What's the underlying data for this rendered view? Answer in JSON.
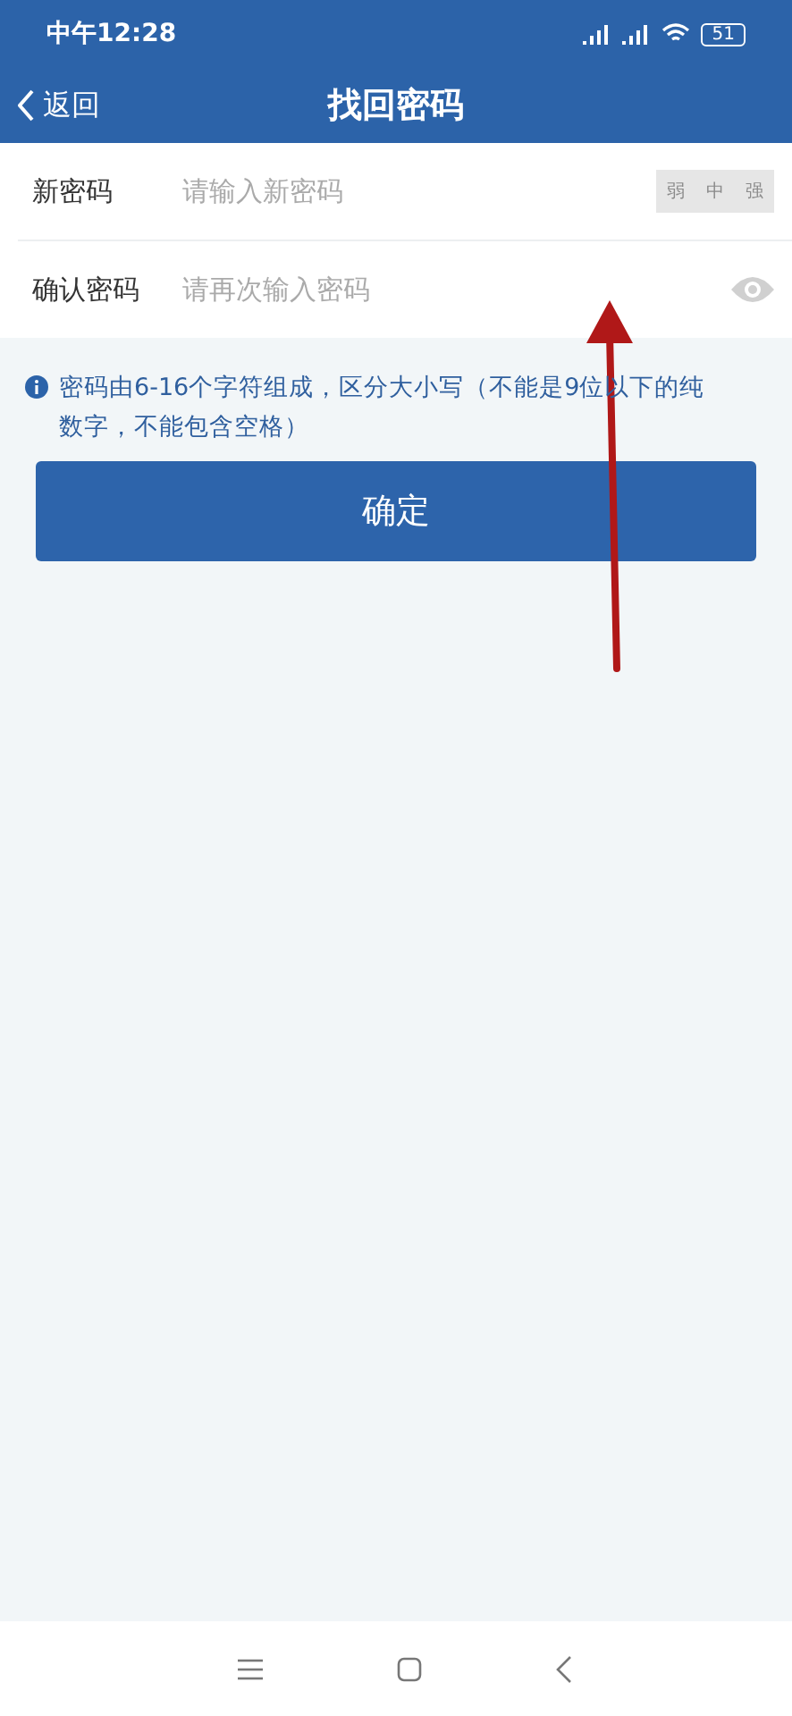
{
  "status_bar": {
    "time": "中午12:28",
    "battery": "51"
  },
  "header": {
    "back": "返回",
    "title": "找回密码"
  },
  "fields": [
    {
      "kind": "strength",
      "label": "新密码",
      "placeholder": "请输入新密码",
      "strength": [
        {
          "label": "弱",
          "active": false
        },
        {
          "label": "中",
          "active": false
        },
        {
          "label": "强",
          "active": false
        }
      ]
    },
    {
      "kind": "reveal",
      "label": "确认密码",
      "placeholder": "请再次输入密码"
    }
  ],
  "hint": "密码由6-16个字符组成，区分大小写（不能是9位以下的纯数字，不能包含空格）",
  "submit": "确定",
  "annotation": {
    "kind": "arrow"
  }
}
